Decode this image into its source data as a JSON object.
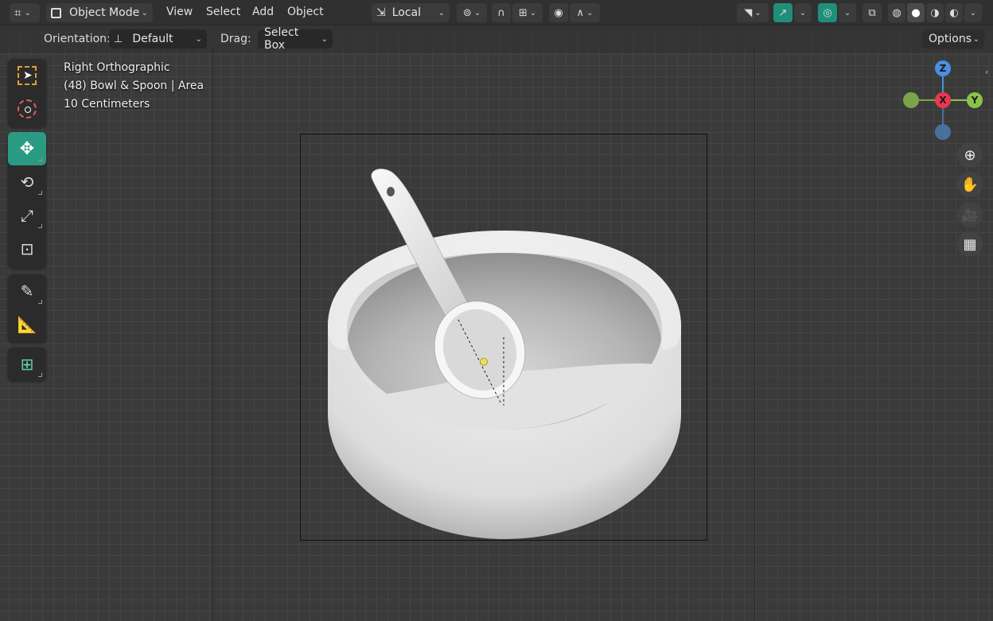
{
  "header": {
    "mode_label": "Object Mode",
    "menus": [
      "View",
      "Select",
      "Add",
      "Object"
    ],
    "transform_orientation": "Local"
  },
  "tool_settings": {
    "orientation_label": "Orientation:",
    "orientation_value": "Default",
    "drag_label": "Drag:",
    "drag_value": "Select Box",
    "options_label": "Options"
  },
  "viewport_info": {
    "view_name": "Right Orthographic",
    "object_info": "(48) Bowl & Spoon | Area",
    "scale": "10 Centimeters"
  },
  "gizmo": {
    "z_label": "Z",
    "x_label": "X",
    "y_label": "Y",
    "colors": {
      "x": "#e8384f",
      "y": "#8bc34a",
      "z": "#4a8fe0",
      "neg_y": "#7ba44a",
      "neg_z": "#4b6f9e"
    }
  },
  "toolbar": {
    "tools": [
      "select-box",
      "cursor",
      "move",
      "rotate",
      "scale",
      "transform",
      "annotate",
      "measure",
      "add-cube"
    ],
    "active_tool": "move"
  },
  "colors": {
    "accent": "#2a9a82",
    "header_bg": "#303030",
    "viewport_bg": "#3a3a3a"
  }
}
